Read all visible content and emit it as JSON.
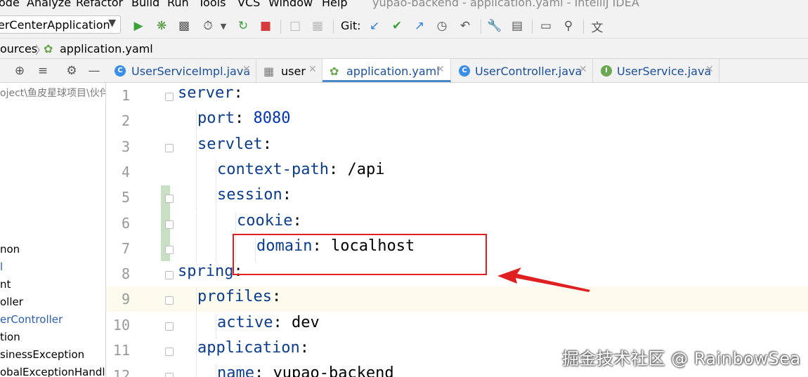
{
  "menu": {
    "items": [
      "ode",
      "Analyze",
      "Refactor",
      "Build",
      "Run",
      "Tools",
      "VCS",
      "Window",
      "Help"
    ],
    "window_title": "yupao-backend - application.yaml - IntelliJ IDEA"
  },
  "toolbar": {
    "run_config": "erCenterApplication",
    "git_label": "Git:"
  },
  "breadcrumb": {
    "parent": "ources",
    "file": "application.yaml"
  },
  "tabs": [
    {
      "label": "UserServiceImpl.java",
      "icon": "C",
      "color": "#3a8ee6"
    },
    {
      "label": "user",
      "icon": "table",
      "color": "#777777"
    },
    {
      "label": "application.yaml",
      "icon": "yaml",
      "color": "#6aa84f"
    },
    {
      "label": "UserController.java",
      "icon": "C",
      "color": "#3a8ee6"
    },
    {
      "label": "UserService.java",
      "icon": "I",
      "color": "#6aa84f"
    }
  ],
  "project": {
    "path": "oject\\鱼皮星球项目\\伙伴",
    "items": [
      {
        "label": "non",
        "blue": false
      },
      {
        "label": "l",
        "blue": true
      },
      {
        "label": "nt",
        "blue": false
      },
      {
        "label": "oller",
        "blue": false
      },
      {
        "label": "erController",
        "blue": true
      },
      {
        "label": "tion",
        "blue": false
      },
      {
        "label": "sinessException",
        "blue": false
      },
      {
        "label": "obalExceptionHandler",
        "blue": false
      }
    ]
  },
  "editor": {
    "lines": [
      {
        "num": "1",
        "indent": 0,
        "key": "server",
        "value": ""
      },
      {
        "num": "2",
        "indent": 1,
        "key": "port",
        "value": "8080"
      },
      {
        "num": "3",
        "indent": 1,
        "key": "servlet",
        "value": ""
      },
      {
        "num": "4",
        "indent": 2,
        "key": "context-path",
        "value": "/api"
      },
      {
        "num": "5",
        "indent": 2,
        "key": "session",
        "value": ""
      },
      {
        "num": "6",
        "indent": 3,
        "key": "cookie",
        "value": ""
      },
      {
        "num": "7",
        "indent": 4,
        "key": "domain",
        "value": "localhost"
      },
      {
        "num": "8",
        "indent": 0,
        "key": "spring",
        "value": ""
      },
      {
        "num": "9",
        "indent": 1,
        "key": "profiles",
        "value": ""
      },
      {
        "num": "10",
        "indent": 2,
        "key": "active",
        "value": "dev"
      },
      {
        "num": "11",
        "indent": 1,
        "key": "application",
        "value": ""
      },
      {
        "num": "12",
        "indent": 2,
        "key": "name",
        "value": "yupao-backend"
      }
    ]
  },
  "annotation": {
    "box_color": "#e02020"
  },
  "watermark": "掘金技术社区 @ RainbowSea"
}
